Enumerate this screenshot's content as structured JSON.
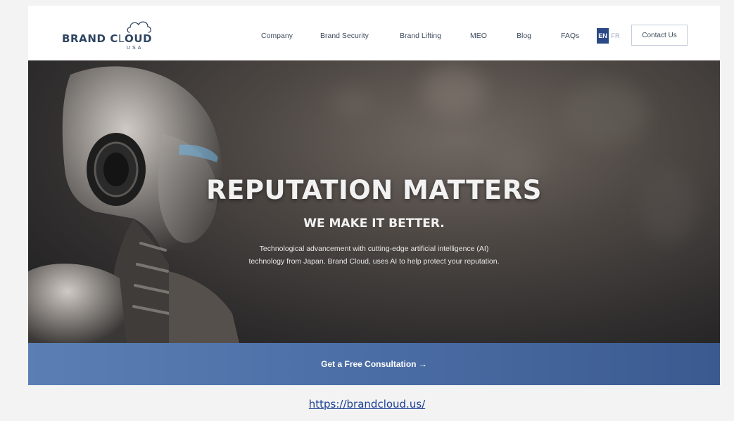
{
  "brand": {
    "name_bold": "BRAND C",
    "name_light": "L",
    "name_rest": "OUD",
    "sub": "USA"
  },
  "nav": [
    {
      "label": "Company"
    },
    {
      "label": "Brand Security"
    },
    {
      "label": "Brand Lifting"
    },
    {
      "label": "MEO"
    },
    {
      "label": "Blog"
    },
    {
      "label": "FAQs"
    }
  ],
  "lang": {
    "en": "EN",
    "fr": "FR"
  },
  "contact_label": "Contact Us",
  "hero": {
    "title": "REPUTATION MATTERS",
    "subtitle": "WE MAKE IT BETTER.",
    "desc_line1": "Technological advancement with cutting-edge artificial intelligence (AI)",
    "desc_line2": "technology from Japan. Brand Cloud, uses AI to help protect your reputation."
  },
  "cta_label": "Get a Free Consultation →",
  "url": "https://brandcloud.us/",
  "colors": {
    "navy": "#2f4560",
    "lang_active": "#2b4a85",
    "cta": "#4b6da5",
    "link": "#1b3f94"
  }
}
